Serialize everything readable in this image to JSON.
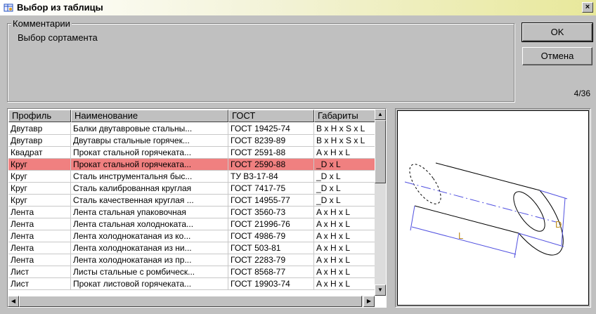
{
  "window": {
    "title": "Выбор из таблицы",
    "close_label": "×"
  },
  "comments": {
    "legend": "Комментарии",
    "text": "Выбор сортамента"
  },
  "buttons": {
    "ok": "OK",
    "cancel": "Отмена"
  },
  "page_counter": "4/36",
  "table": {
    "columns": [
      "Профиль",
      "Наименование",
      "ГОСТ",
      "Габариты"
    ],
    "selected_row": 3,
    "rows": [
      [
        "Двутавр",
        "Балки двутавровые стальны...",
        "ГОСТ 19425-74",
        "B x H x S x L"
      ],
      [
        "Двутавр",
        "Двутавры стальные горячек...",
        "ГОСТ 8239-89",
        "B x H x S x L"
      ],
      [
        "Квадрат",
        "Прокат стальной горячеката...",
        "ГОСТ 2591-88",
        "A x H x L"
      ],
      [
        "Круг",
        "Прокат стальной горячеката...",
        "ГОСТ 2590-88",
        "_D x L"
      ],
      [
        "Круг",
        "Сталь инструментальня быс...",
        "ТУ В3-17-84",
        "_D x L"
      ],
      [
        "Круг",
        "Сталь калиброванная круглая",
        "ГОСТ 7417-75",
        "_D x L"
      ],
      [
        "Круг",
        "Сталь качественная круглая ...",
        "ГОСТ 14955-77",
        "_D x L"
      ],
      [
        "Лента",
        "Лента стальная упаковочная",
        "ГОСТ 3560-73",
        "A x H x L"
      ],
      [
        "Лента",
        "Лента стальная холодноката...",
        "ГОСТ 21996-76",
        "A x H x L"
      ],
      [
        "Лента",
        "Лента холоднокатаная из ко...",
        "ГОСТ 4986-79",
        "A x H x L"
      ],
      [
        "Лента",
        "Лента холоднокатаная из ни...",
        "ГОСТ 503-81",
        "A x H x L"
      ],
      [
        "Лента",
        "Лента холоднокатаная из пр...",
        "ГОСТ 2283-79",
        "A x H x L"
      ],
      [
        "Лист",
        "Листы стальные с ромбическ...",
        "ГОСТ 8568-77",
        "A x H x L"
      ],
      [
        "Лист",
        "Прокат листовой горячеката...",
        "ГОСТ 19903-74",
        "A x H x L"
      ]
    ]
  },
  "preview": {
    "label_length": "L",
    "label_diameter": "D"
  },
  "colors": {
    "selection": "#f08080",
    "dimension_lines": "#5050e0",
    "dimension_text": "#c09020"
  },
  "icons": {
    "app": "app-table-icon",
    "scroll_up": "arrow-up-icon",
    "scroll_down": "arrow-down-icon",
    "scroll_left": "arrow-left-icon",
    "scroll_right": "arrow-right-icon"
  }
}
